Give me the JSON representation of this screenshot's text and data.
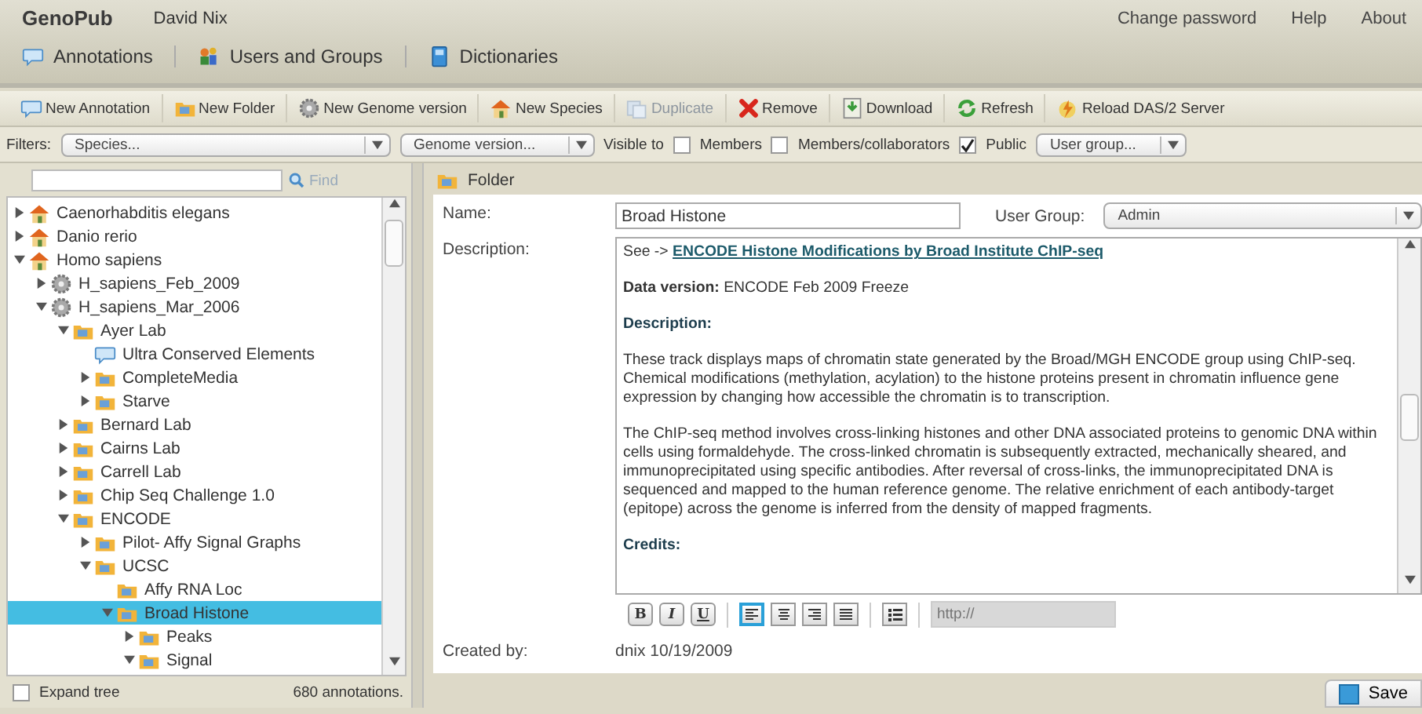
{
  "app": {
    "title": "GenoPub",
    "user": "David Nix",
    "links": [
      "Change password",
      "Help",
      "About"
    ]
  },
  "nav_tabs": [
    {
      "label": "Annotations"
    },
    {
      "label": "Users and Groups"
    },
    {
      "label": "Dictionaries"
    }
  ],
  "toolbar": [
    {
      "label": "New Annotation",
      "disabled": false
    },
    {
      "label": "New Folder",
      "disabled": false
    },
    {
      "label": "New Genome version",
      "disabled": false
    },
    {
      "label": "New Species",
      "disabled": false
    },
    {
      "label": "Duplicate",
      "disabled": true
    },
    {
      "label": "Remove",
      "disabled": false
    },
    {
      "label": "Download",
      "disabled": false
    },
    {
      "label": "Refresh",
      "disabled": false
    },
    {
      "label": "Reload DAS/2 Server",
      "disabled": false
    }
  ],
  "filters": {
    "label": "Filters:",
    "species": "Species...",
    "genome_version": "Genome version...",
    "visible_to": "Visible to",
    "checkboxes": [
      {
        "label": "Members",
        "checked": false
      },
      {
        "label": "Members/collaborators",
        "checked": false
      },
      {
        "label": "Public",
        "checked": true
      }
    ],
    "user_group": "User group..."
  },
  "tree_panel": {
    "find": "Find",
    "tree": [
      {
        "label": "Caenorhabditis elegans",
        "kind": "species",
        "expanded": false,
        "selected": false
      },
      {
        "label": "Danio rerio",
        "kind": "species",
        "expanded": false,
        "selected": false
      },
      {
        "label": "Homo sapiens",
        "kind": "species",
        "expanded": true,
        "selected": false,
        "children": [
          {
            "label": "H_sapiens_Feb_2009",
            "kind": "genome",
            "expanded": false,
            "selected": false
          },
          {
            "label": "H_sapiens_Mar_2006",
            "kind": "genome",
            "expanded": true,
            "selected": false,
            "children": [
              {
                "label": "Ayer Lab",
                "kind": "folder",
                "expanded": true,
                "selected": false,
                "children": [
                  {
                    "label": "Ultra Conserved Elements",
                    "kind": "annotation",
                    "selected": false
                  },
                  {
                    "label": "CompleteMedia",
                    "kind": "folder",
                    "expanded": false,
                    "selected": false
                  },
                  {
                    "label": "Starve",
                    "kind": "folder",
                    "expanded": false,
                    "selected": false
                  }
                ]
              },
              {
                "label": "Bernard Lab",
                "kind": "folder",
                "expanded": false,
                "selected": false
              },
              {
                "label": "Cairns Lab",
                "kind": "folder",
                "expanded": false,
                "selected": false
              },
              {
                "label": "Carrell Lab",
                "kind": "folder",
                "expanded": false,
                "selected": false
              },
              {
                "label": "Chip Seq Challenge 1.0",
                "kind": "folder",
                "expanded": false,
                "selected": false
              },
              {
                "label": "ENCODE",
                "kind": "folder",
                "expanded": true,
                "selected": false,
                "children": [
                  {
                    "label": "Pilot- Affy Signal Graphs",
                    "kind": "folder",
                    "expanded": false,
                    "selected": false
                  },
                  {
                    "label": "UCSC",
                    "kind": "folder",
                    "expanded": true,
                    "selected": false,
                    "children": [
                      {
                        "label": "Affy RNA Loc",
                        "kind": "folder",
                        "selected": false
                      },
                      {
                        "label": "Broad Histone",
                        "kind": "folder",
                        "expanded": true,
                        "selected": true,
                        "children": [
                          {
                            "label": "Peaks",
                            "kind": "folder",
                            "expanded": false,
                            "selected": false
                          },
                          {
                            "label": "Signal",
                            "kind": "folder",
                            "expanded": true,
                            "selected": false
                          }
                        ]
                      }
                    ]
                  }
                ]
              }
            ]
          }
        ]
      }
    ],
    "expand_tree": {
      "label": "Expand tree",
      "checked": false
    },
    "count": "680 annotations."
  },
  "detail": {
    "title": "Folder",
    "name_label": "Name:",
    "name": "Broad Histone",
    "user_group_label": "User Group:",
    "user_group": "Admin",
    "description_label": "Description:",
    "description": [
      {
        "kind": "link",
        "prefix": "See ->",
        "link": "ENCODE Histone Modifications by Broad Institute ChIP-seq"
      },
      {
        "kind": "text",
        "text": "**Data version:** ENCODE Feb 2009 Freeze"
      },
      {
        "kind": "heading",
        "text": "Description:"
      },
      {
        "kind": "text",
        "text": "These track displays maps of chromatin state generated by the Broad/MGH ENCODE group using ChIP-seq. Chemical modifications (methylation, acylation) to the histone proteins present in chromatin influence gene expression by changing how accessible the chromatin is to transcription."
      },
      {
        "kind": "text",
        "text": "The ChIP-seq method involves cross-linking histones and other DNA associated proteins to genomic DNA within cells using formaldehyde. The cross-linked chromatin is subsequently extracted, mechanically sheared, and immunoprecipitated using specific antibodies. After reversal of cross-links, the immunoprecipitated DNA is sequenced and mapped to the human reference genome. The relative enrichment of each antibody-target (epitope) across the genome is inferred from the density of mapped fragments."
      },
      {
        "kind": "heading",
        "text": "Credits:"
      }
    ],
    "format_buttons": [
      "B",
      "I",
      "U"
    ],
    "align_buttons": [
      {
        "kind": "left",
        "selected": true
      },
      {
        "kind": "center",
        "selected": false
      },
      {
        "kind": "right",
        "selected": false
      },
      {
        "kind": "justify",
        "selected": false
      }
    ],
    "url_placeholder": "http://",
    "created_label": "Created by:",
    "created": "dnix 10/19/2009",
    "save": "Save"
  }
}
